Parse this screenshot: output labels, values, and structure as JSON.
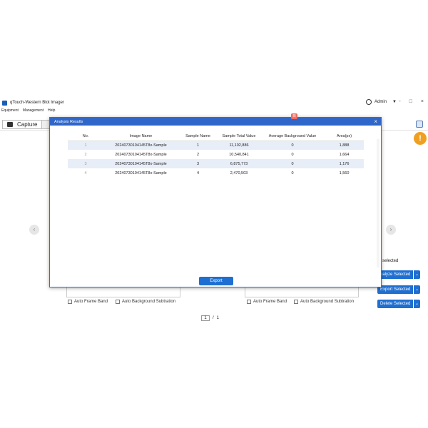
{
  "app": {
    "title": "qTouch-Western Blot Imager",
    "user": "Admin",
    "window_controls": [
      "-",
      "□",
      "×"
    ]
  },
  "menu": [
    "Equipment",
    "Management",
    "Help"
  ],
  "toolbar": {
    "capture_label": "Capture"
  },
  "side": {
    "selected_text": "selected"
  },
  "actions": {
    "analyze_label": "nalyze Selected",
    "export_label": "Export Selected",
    "delete_label": "Delete Selected",
    "dropdown_glyph": "⌄"
  },
  "options": {
    "auto_frame_band": "Auto Frame Band",
    "auto_background_subtraction": "Auto Background Subtration"
  },
  "pager": {
    "current": "1",
    "separator": "/",
    "total": "1"
  },
  "modal": {
    "title": "Analysis Results",
    "close": "×",
    "badge": "目",
    "export_label": "Export",
    "columns": [
      "No.",
      "Image Name",
      "Sample Name",
      "Sample Total Value",
      "Average Background Value",
      "Area(px)"
    ],
    "rows": [
      {
        "no": "1",
        "image_name": "20240730104145T8x-Sample",
        "sample_name": "1",
        "total": "11,102,886",
        "background": "0",
        "area": "1,888"
      },
      {
        "no": "2",
        "image_name": "20240730104145T8x-Sample",
        "sample_name": "2",
        "total": "10,540,841",
        "background": "0",
        "area": "1,664"
      },
      {
        "no": "3",
        "image_name": "20240730104145T8x-Sample",
        "sample_name": "3",
        "total": "6,875,773",
        "background": "0",
        "area": "1,176"
      },
      {
        "no": "4",
        "image_name": "20240730104145T8x-Sample",
        "sample_name": "4",
        "total": "2,470,503",
        "background": "0",
        "area": "1,560"
      }
    ]
  },
  "icons": {
    "warning": "!",
    "prev": "‹",
    "next": "›"
  },
  "colors": {
    "accent": "#1f6fd1",
    "modal_header": "#2f66c9",
    "warning": "#f0a020"
  }
}
